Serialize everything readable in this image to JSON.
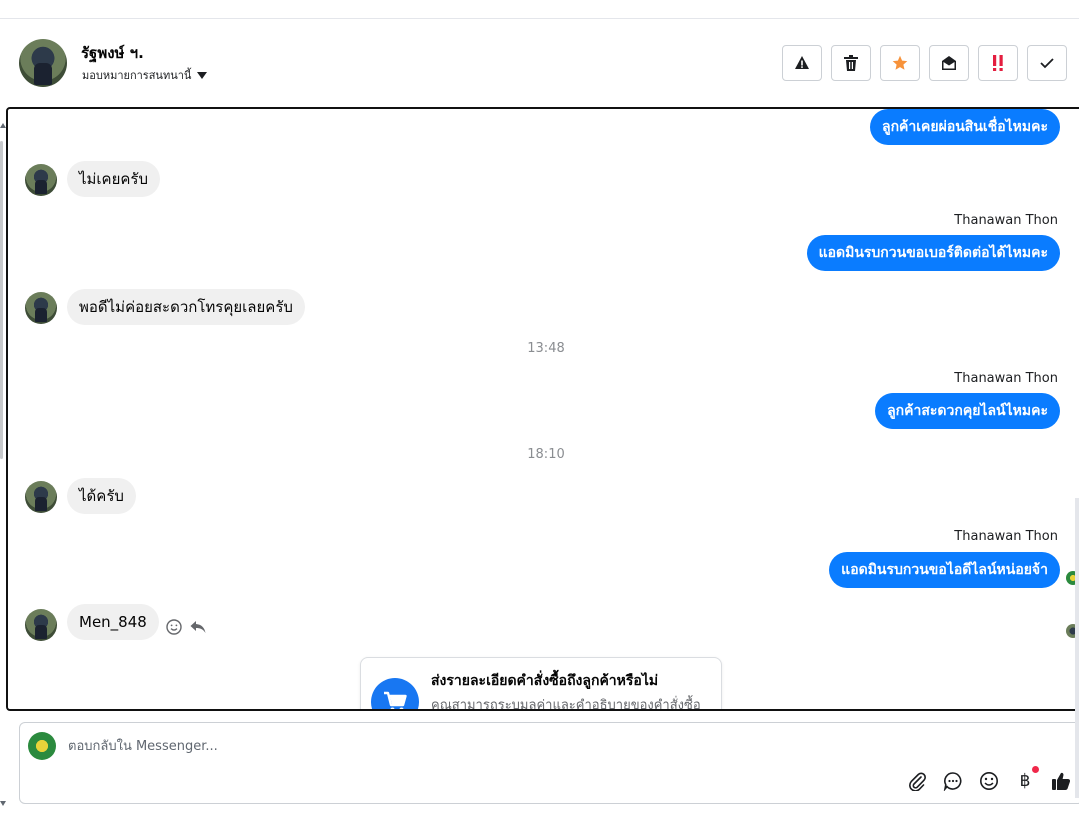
{
  "header": {
    "contact_name": "รัฐพงษ์ ฯ.",
    "assign_label": "มอบหมายการสนทนานี้",
    "actions": [
      {
        "name": "spam",
        "icon": "warning-icon"
      },
      {
        "name": "delete",
        "icon": "trash-icon"
      },
      {
        "name": "star",
        "icon": "star-icon"
      },
      {
        "name": "mark-unread",
        "icon": "envelope-open-icon"
      },
      {
        "name": "follow-up",
        "icon": "exclamation-icon"
      },
      {
        "name": "done",
        "icon": "check-icon"
      }
    ]
  },
  "messages": {
    "m1": "ลูกค้าเคยผ่อนสินเชื่อไหมคะ",
    "m2": "ไม่เคยครับ",
    "m3_sender": "Thanawan Thon",
    "m3": "แอดมินรบกวนขอเบอร์ติดต่อได้ไหมคะ",
    "m4": "พอดีไม่ค่อยสะดวกโทรคุยเลยครับ",
    "ts1": "13:48",
    "m5_sender": "Thanawan Thon",
    "m5": "ลูกค้าสะดวกคุยไลน์ไหมคะ",
    "ts2": "18:10",
    "m6": "ได้ครับ",
    "m7_sender": "Thanawan Thon",
    "m7": "แอดมินรบกวนขอไอดีไลน์หน่อยจ้า",
    "m8": "Men_848"
  },
  "order_card": {
    "title": "ส่งรายละเอียดคำสั่งซื้อถึงลูกค้าหรือไม่",
    "subtitle": "คุณสามารถระบุมูลค่าและคำอธิบายของคำสั่งซื้อ"
  },
  "composer": {
    "placeholder": "ตอบกลับใน Messenger...",
    "tools": [
      "paperclip-icon",
      "chat-bubble-icon",
      "emoji-icon",
      "baht-icon",
      "thumbs-up-icon"
    ],
    "baht_symbol": "฿"
  },
  "colors": {
    "outgoing_bubble": "#0a7cff",
    "incoming_bubble": "#f0f0f0",
    "star": "#f7923a",
    "followup": "#e41e3f"
  }
}
